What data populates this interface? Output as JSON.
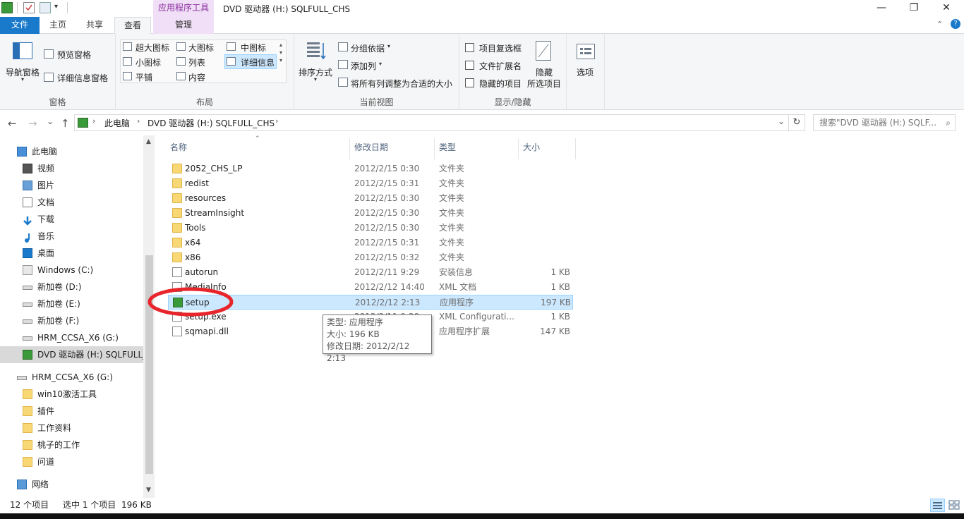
{
  "window": {
    "title": "DVD 驱动器 (H:) SQLFULL_CHS",
    "context_tab_group": "应用程序工具",
    "controls": [
      "—",
      "❐",
      "✕"
    ]
  },
  "ribbon_tabs": {
    "file": "文件",
    "home": "主页",
    "share": "共享",
    "view": "查看",
    "manage": "管理"
  },
  "ribbon": {
    "panes": {
      "label": "窗格",
      "nav_pane": "导航窗格",
      "preview_pane": "预览窗格",
      "details_pane": "详细信息窗格"
    },
    "layout": {
      "label": "布局",
      "extra_large": "超大图标",
      "large": "大图标",
      "medium": "中图标",
      "small": "小图标",
      "list": "列表",
      "details": "详细信息",
      "tiles": "平铺",
      "content": "内容"
    },
    "current_view": {
      "label": "当前视图",
      "sort_by": "排序方式",
      "group_by": "分组依据",
      "add_columns": "添加列",
      "size_all_columns": "将所有列调整为合适的大小"
    },
    "show_hide": {
      "label": "显示/隐藏",
      "item_checkboxes": "项目复选框",
      "file_extensions": "文件扩展名",
      "hidden_items": "隐藏的项目",
      "hide_selected": "隐藏",
      "hide_selected_2": "所选项目"
    },
    "options": "选项"
  },
  "address": {
    "segments": [
      "此电脑",
      "DVD 驱动器 (H:) SQLFULL_CHS"
    ],
    "search_placeholder": "搜索\"DVD 驱动器 (H:) SQLF...",
    "back": "←",
    "forward": "→",
    "up": "↑",
    "dropdown": "⌄",
    "refresh": "↻"
  },
  "nav": [
    {
      "label": "此电脑",
      "icon": "computer-icon",
      "indent": 0
    },
    {
      "label": "视频",
      "icon": "video-folder-icon",
      "indent": 1
    },
    {
      "label": "图片",
      "icon": "pictures-folder-icon",
      "indent": 1
    },
    {
      "label": "文档",
      "icon": "documents-folder-icon",
      "indent": 1
    },
    {
      "label": "下载",
      "icon": "download-icon",
      "indent": 1
    },
    {
      "label": "音乐",
      "icon": "music-icon",
      "indent": 1
    },
    {
      "label": "桌面",
      "icon": "desktop-icon",
      "indent": 1
    },
    {
      "label": "Windows (C:)",
      "icon": "windows-drive-icon",
      "indent": 1
    },
    {
      "label": "新加卷 (D:)",
      "icon": "drive-icon",
      "indent": 1
    },
    {
      "label": "新加卷 (E:)",
      "icon": "drive-icon",
      "indent": 1
    },
    {
      "label": "新加卷 (F:)",
      "icon": "drive-icon",
      "indent": 1
    },
    {
      "label": "HRM_CCSA_X6 (G:)",
      "icon": "drive-icon",
      "indent": 1
    },
    {
      "label": "DVD 驱动器 (H:) SQLFULL_",
      "icon": "dvd-drive-icon",
      "indent": 1,
      "selected": true
    },
    {
      "label": "HRM_CCSA_X6 (G:)",
      "icon": "drive-icon",
      "indent": 0
    },
    {
      "label": "win10激活工具",
      "icon": "folder-icon",
      "indent": 1
    },
    {
      "label": "插件",
      "icon": "folder-icon",
      "indent": 1
    },
    {
      "label": "工作资料",
      "icon": "folder-icon",
      "indent": 1
    },
    {
      "label": "桃子的工作",
      "icon": "folder-icon",
      "indent": 1
    },
    {
      "label": "问道",
      "icon": "folder-icon",
      "indent": 1
    },
    {
      "label": "网络",
      "icon": "network-icon",
      "indent": 0
    }
  ],
  "columns": {
    "name": "名称",
    "modified": "修改日期",
    "type": "类型",
    "size": "大小"
  },
  "files": [
    {
      "name": "2052_CHS_LP",
      "modified": "2012/2/15 0:30",
      "type": "文件夹",
      "size": "",
      "icon": "folder-icon"
    },
    {
      "name": "redist",
      "modified": "2012/2/15 0:31",
      "type": "文件夹",
      "size": "",
      "icon": "folder-icon"
    },
    {
      "name": "resources",
      "modified": "2012/2/15 0:30",
      "type": "文件夹",
      "size": "",
      "icon": "folder-icon"
    },
    {
      "name": "StreamInsight",
      "modified": "2012/2/15 0:30",
      "type": "文件夹",
      "size": "",
      "icon": "folder-icon"
    },
    {
      "name": "Tools",
      "modified": "2012/2/15 0:30",
      "type": "文件夹",
      "size": "",
      "icon": "folder-icon"
    },
    {
      "name": "x64",
      "modified": "2012/2/15 0:31",
      "type": "文件夹",
      "size": "",
      "icon": "folder-icon"
    },
    {
      "name": "x86",
      "modified": "2012/2/15 0:32",
      "type": "文件夹",
      "size": "",
      "icon": "folder-icon"
    },
    {
      "name": "autorun",
      "modified": "2012/2/11 9:29",
      "type": "安装信息",
      "size": "1 KB",
      "icon": "settings-file-icon"
    },
    {
      "name": "MediaInfo",
      "modified": "2012/2/12 14:40",
      "type": "XML 文档",
      "size": "1 KB",
      "icon": "xml-file-icon"
    },
    {
      "name": "setup",
      "modified": "2012/2/12 2:13",
      "type": "应用程序",
      "size": "197 KB",
      "icon": "setup-app-icon",
      "selected": true
    },
    {
      "name": "setup.exe",
      "modified": "2012/2/11 9:29",
      "type": "XML Configurati...",
      "size": "1 KB",
      "icon": "config-file-icon"
    },
    {
      "name": "sqmapi.dll",
      "modified": "",
      "type": "应用程序扩展",
      "size": "147 KB",
      "icon": "dll-file-icon"
    }
  ],
  "tooltip": {
    "line1": "类型: 应用程序",
    "line2": "大小: 196 KB",
    "line3": "修改日期: 2012/2/12 2:13"
  },
  "status": {
    "count": "12 个项目",
    "selection": "选中 1 个项目",
    "size": "196 KB"
  },
  "colors": {
    "file_tab": "#1979ca",
    "context_tab": "#f0dff7",
    "selection": "#cce8ff",
    "highlight_circle": "#e8252b"
  }
}
